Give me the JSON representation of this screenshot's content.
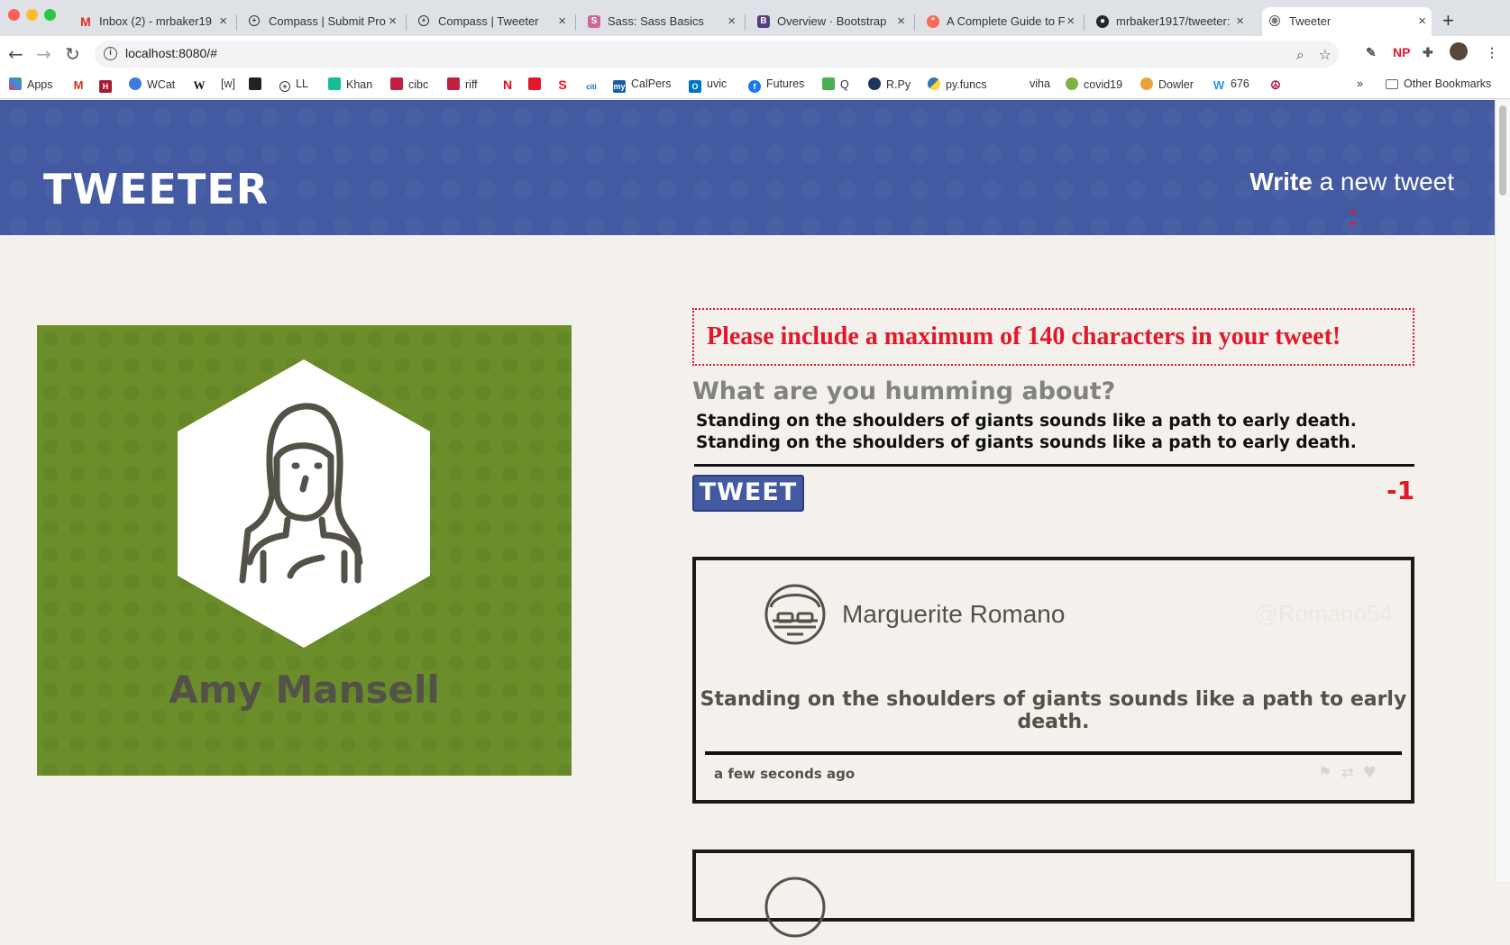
{
  "browser": {
    "tabs": [
      {
        "title": "Inbox (2) - mrbaker19",
        "icon": "gmail-icon"
      },
      {
        "title": "Compass | Submit Pro",
        "icon": "compass-icon"
      },
      {
        "title": "Compass | Tweeter",
        "icon": "compass-icon"
      },
      {
        "title": "Sass: Sass Basics",
        "icon": "sass-icon"
      },
      {
        "title": "Overview · Bootstrap",
        "icon": "bootstrap-icon"
      },
      {
        "title": "A Complete Guide to F",
        "icon": "css-tricks-icon"
      },
      {
        "title": "mrbaker1917/tweeter:",
        "icon": "github-icon"
      },
      {
        "title": "Tweeter",
        "icon": "globe-icon"
      }
    ],
    "url": "localhost:8080/#",
    "bookmarks": [
      "Apps",
      "",
      "",
      "WCat",
      "",
      "[w]",
      "",
      "LL",
      "Khan",
      "cibc",
      "riff",
      "",
      "",
      "",
      "",
      "CalPers",
      "uvic",
      "Futures",
      "Q",
      "R.Py",
      "py.funcs",
      "viha",
      "covid19",
      "Dowler",
      "676",
      ""
    ],
    "other_bookmarks": "Other Bookmarks",
    "overflow": "»"
  },
  "site": {
    "logo": "TWEETER",
    "compose_toggle_bold": "Write",
    "compose_toggle_rest": " a new tweet",
    "toggle_arrow": "⌄"
  },
  "profile": {
    "name": "Amy Mansell",
    "bg_color": "#6b8e2a"
  },
  "compose": {
    "error": "Please include a maximum of 140 characters in your tweet!",
    "label": "What are you humming about?",
    "text": "Standing on the shoulders of giants sounds like a path to early death. Standing on the shoulders of giants sounds like a path to early death.",
    "button": "TWEET",
    "counter": "-1"
  },
  "tweets": [
    {
      "name": "Marguerite Romano",
      "handle": "@Romano54",
      "body": "Standing on the shoulders of giants sounds like a path to early death.",
      "time": "a few seconds ago"
    }
  ]
}
